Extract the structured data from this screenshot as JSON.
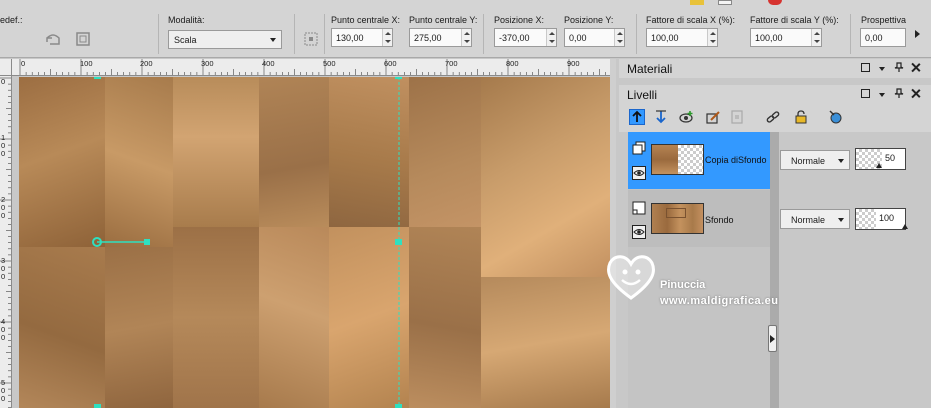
{
  "toolbar": {
    "preset_label": "edef.:",
    "mode": {
      "label": "Modalità:",
      "value": "Scala"
    },
    "center_x": {
      "label": "Punto centrale X:",
      "value": "130,00"
    },
    "center_y": {
      "label": "Punto centrale Y:",
      "value": "275,00"
    },
    "pos_x": {
      "label": "Posizione X:",
      "value": "-370,00"
    },
    "pos_y": {
      "label": "Posizione Y:",
      "value": "0,00"
    },
    "scale_x": {
      "label": "Fattore di scala X (%):",
      "value": "100,00"
    },
    "scale_y": {
      "label": "Fattore di scala Y (%):",
      "value": "100,00"
    },
    "perspective": {
      "label": "Prospettiva",
      "value": "0,00"
    }
  },
  "ruler_h": [
    "0",
    "100",
    "200",
    "300",
    "400",
    "500",
    "600",
    "700",
    "800",
    "900"
  ],
  "ruler_v": [
    "0",
    "1\n0\n0",
    "2\n0\n0",
    "3\n0\n0",
    "4\n0\n0",
    "5\n0\n0"
  ],
  "panels": {
    "materials": {
      "title": "Materiali"
    },
    "layers": {
      "title": "Livelli"
    }
  },
  "layers": [
    {
      "name": "Copia diSfondo",
      "blend": "Normale",
      "opacity": "50",
      "active": true
    },
    {
      "name": "Sfondo",
      "blend": "Normale",
      "opacity": "100",
      "active": false
    }
  ],
  "watermark": {
    "line1": "Pinuccia",
    "line2": "www.maldigrafica.eu"
  },
  "colors": {
    "selected_layer": "#3399ff",
    "guide": "#33ccaa",
    "canvas": "#a87c4e"
  }
}
